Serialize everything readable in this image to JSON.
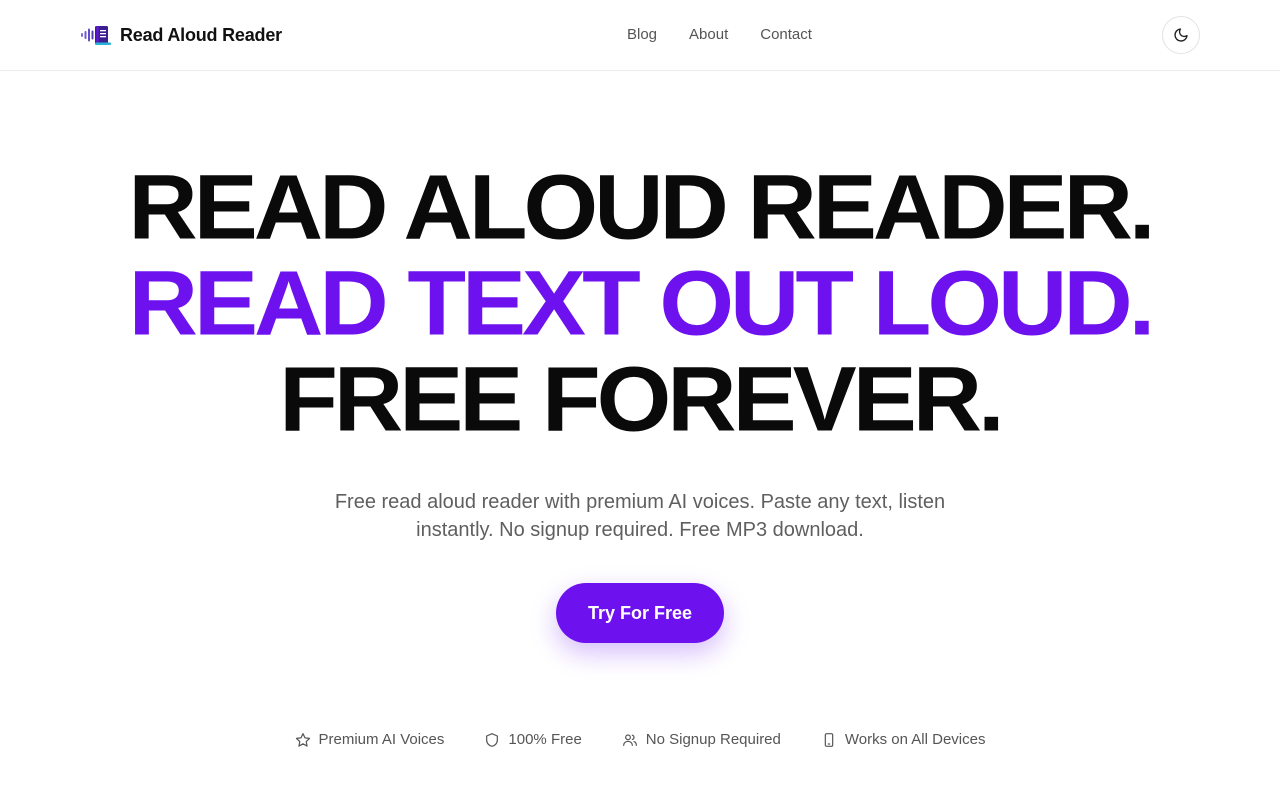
{
  "header": {
    "brand_name": "Read Aloud Reader",
    "brand_logo_icon": "book-soundwave-icon",
    "nav": [
      {
        "label": "Blog"
      },
      {
        "label": "About"
      },
      {
        "label": "Contact"
      }
    ],
    "theme_toggle_icon": "moon-icon"
  },
  "hero": {
    "line1": "READ ALOUD READER.",
    "line2": "READ TEXT OUT LOUD.",
    "line3": "FREE FOREVER.",
    "subtitle": "Free read aloud reader with premium AI voices. Paste any text, listen instantly. No signup required. Free MP3 download.",
    "cta_label": "Try For Free"
  },
  "features": [
    {
      "label": "Premium AI Voices",
      "icon": "star-icon"
    },
    {
      "label": "100% Free",
      "icon": "shield-icon"
    },
    {
      "label": "No Signup Required",
      "icon": "users-icon"
    },
    {
      "label": "Works on All Devices",
      "icon": "smartphone-icon"
    }
  ],
  "colors": {
    "accent": "#6d12ef",
    "text": "#0a0a0a",
    "muted": "#5f5f5f"
  }
}
